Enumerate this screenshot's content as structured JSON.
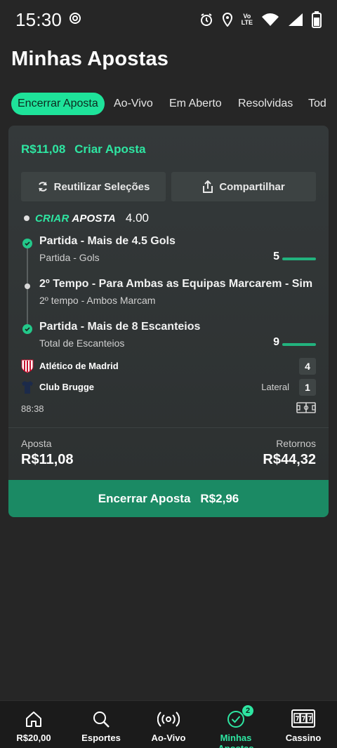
{
  "status_bar": {
    "time": "15:30",
    "icons": [
      "gear-icon",
      "alarm-icon",
      "location-icon",
      "volte-icon",
      "wifi-icon",
      "signal-icon",
      "battery-icon"
    ],
    "volte_top": "Vo",
    "volte_bottom": "LTE"
  },
  "page": {
    "title": "Minhas Apostas"
  },
  "tabs": [
    {
      "label": "Encerrar Aposta",
      "active": true
    },
    {
      "label": "Ao-Vivo"
    },
    {
      "label": "Em Aberto"
    },
    {
      "label": "Resolvidas"
    },
    {
      "label": "Tod"
    }
  ],
  "bet": {
    "amount": "R$11,08",
    "type_label": "Criar Aposta",
    "reuse_button": "Reutilizar Seleções",
    "share_button": "Compartilhar",
    "builder_name_a": "CRIAR",
    "builder_name_b": "APOSTA",
    "builder_odds": "4.00",
    "legs": [
      {
        "title": "Partida - Mais de 4.5 Gols",
        "subtitle": "Partida - Gols",
        "value": "5",
        "status": "won"
      },
      {
        "title": "2º Tempo - Para Ambas as Equipas Marcarem - Sim",
        "subtitle": "2º tempo - Ambos Marcam",
        "value": "",
        "status": "pending"
      },
      {
        "title": "Partida - Mais de 8 Escanteios",
        "subtitle": "Total de Escanteios",
        "value": "9",
        "status": "won"
      }
    ],
    "teams": [
      {
        "name": "Atlético de Madrid",
        "score": "4",
        "note": ""
      },
      {
        "name": "Club Brugge",
        "score": "1",
        "note": "Lateral"
      }
    ],
    "match_clock": "88:38",
    "stake_label": "Aposta",
    "stake_value": "R$11,08",
    "returns_label": "Retornos",
    "returns_value": "R$44,32",
    "cashout_label": "Encerrar Aposta",
    "cashout_value": "R$2,96"
  },
  "bottom_nav": [
    {
      "label": "R$20,00",
      "icon": "home-icon"
    },
    {
      "label": "Esportes",
      "icon": "search-icon"
    },
    {
      "label": "Ao-Vivo",
      "icon": "live-icon"
    },
    {
      "label": "Minhas Apostas",
      "icon": "check-circle-icon",
      "badge": "2",
      "active": true
    },
    {
      "label": "Cassino",
      "icon": "slot-machine-icon"
    }
  ],
  "colors": {
    "accent": "#2ee6a2",
    "background": "#262626",
    "card": "#343939",
    "cashout_button": "#1b8a64"
  }
}
